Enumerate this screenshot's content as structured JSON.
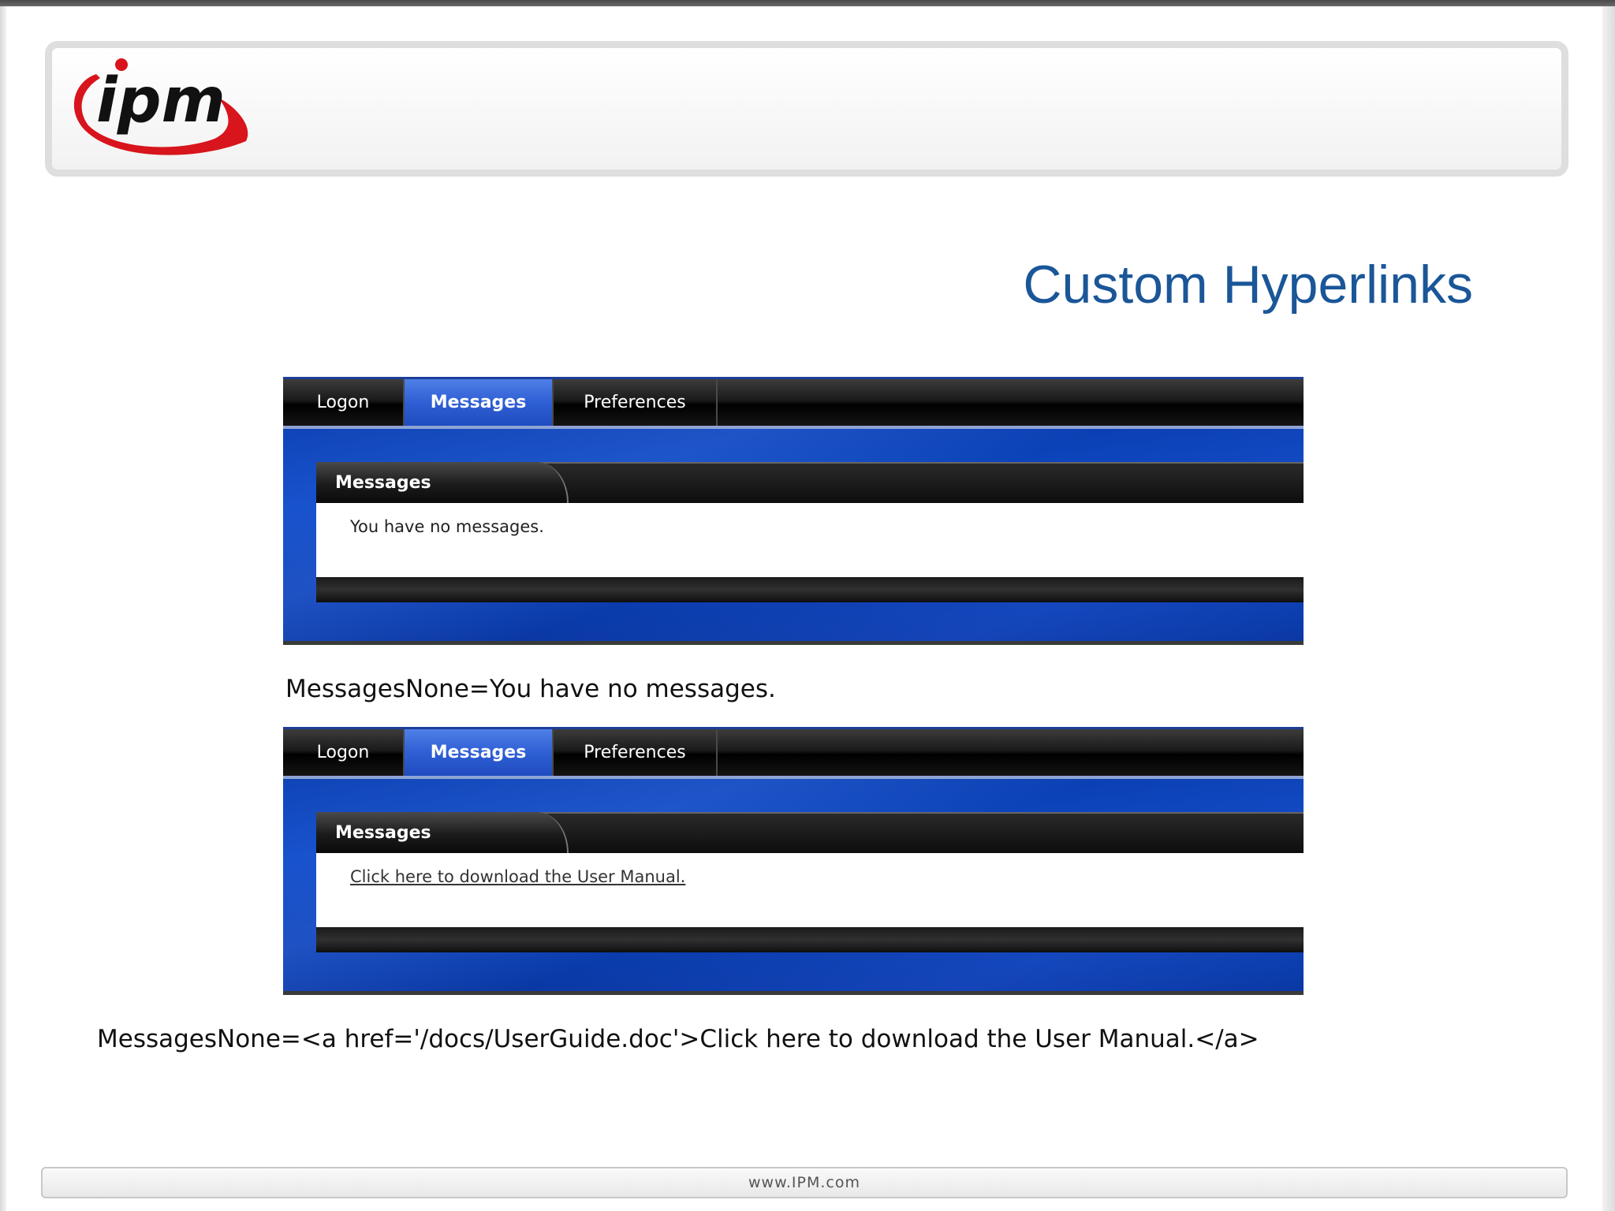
{
  "header": {
    "logo_text": "ipm"
  },
  "slide": {
    "title": "Custom Hyperlinks"
  },
  "shot1": {
    "tabs": [
      "Logon",
      "Messages",
      "Preferences"
    ],
    "panel_title": "Messages",
    "panel_text": "You have no messages."
  },
  "caption1": "MessagesNone=You have no messages.",
  "shot2": {
    "tabs": [
      "Logon",
      "Messages",
      "Preferences"
    ],
    "panel_title": "Messages",
    "panel_link": "Click here to download the User Manual."
  },
  "caption2": "MessagesNone=<a href='/docs/UserGuide.doc'>Click here to download the User Manual.</a>",
  "footer": {
    "url": "www.IPM.com"
  },
  "colors": {
    "title_blue": "#1a5698",
    "logo_red": "#d8141c",
    "app_blue": "#0c48c4",
    "active_tab": "#2f5fd4"
  }
}
